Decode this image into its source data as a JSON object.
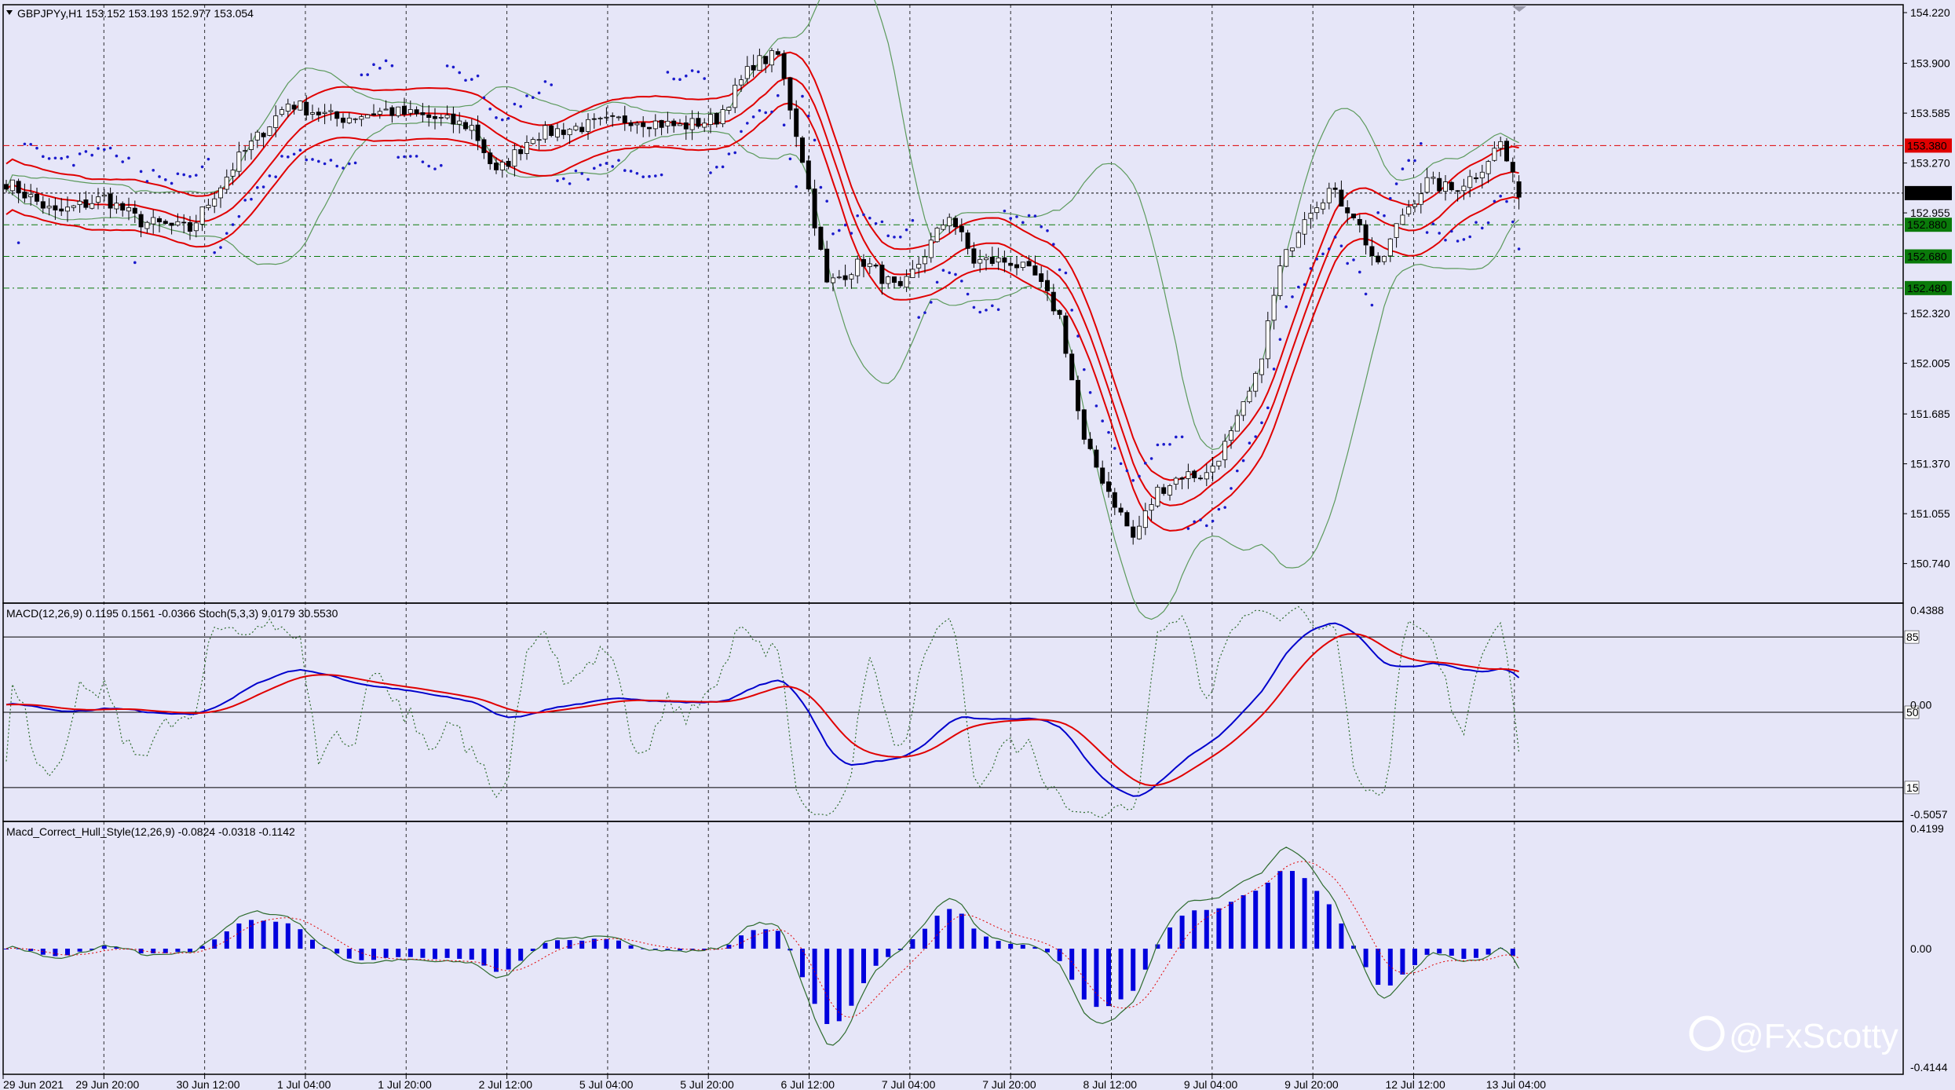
{
  "colors": {
    "background": "#e6e6f8",
    "grid": "#000000",
    "bull_candle": "#ffffff",
    "bear_candle": "#000000",
    "ma_red": "#e00000",
    "bollinger": "#5c9a5c",
    "sar": "#1a1acc",
    "macd_blue": "#0000cc",
    "macd_red": "#e00000",
    "stoch_green": "#2d6b2d",
    "hull_hist": "#0000dd",
    "price_red": "#e00000",
    "price_green": "#0a7a0a",
    "price_current": "#000000"
  },
  "header": {
    "symbol_line": "GBPJPYy,H1  153.152 153.193 152.977 153.054",
    "macd_line": "MACD(12,26,9) 0.1195 0.1561 -0.0366  Stoch(5,3,3) 9.0179 30.5530",
    "hull_line": "Macd_Correct_Hull_Style(12,26,9) -0.0824 -0.0318 -0.1142"
  },
  "watermark": "@FxScotty",
  "chart_data": [
    {
      "type": "candlestick",
      "title": "GBPJPYy,H1",
      "ylim": [
        150.5,
        154.26
      ],
      "price_ticks": [
        "154.220",
        "153.900",
        "153.585",
        "153.270",
        "152.955",
        "152.320",
        "152.005",
        "151.685",
        "151.370",
        "151.055",
        "150.740"
      ],
      "price_ticks_values": [
        154.22,
        153.9,
        153.585,
        153.27,
        152.955,
        152.32,
        152.005,
        151.685,
        151.37,
        151.055,
        150.74
      ],
      "levels": [
        {
          "label": "153.380",
          "value": 153.38,
          "color": "red"
        },
        {
          "label": "153.080",
          "value": 153.08,
          "color": "current"
        },
        {
          "label": "152.880",
          "value": 152.88,
          "color": "green"
        },
        {
          "label": "152.680",
          "value": 152.68,
          "color": "green"
        },
        {
          "label": "152.480",
          "value": 152.48,
          "color": "green"
        }
      ],
      "x_labels": [
        "29 Jun 2021",
        "29 Jun 20:00",
        "30 Jun 12:00",
        "1 Jul 04:00",
        "1 Jul 20:00",
        "2 Jul 12:00",
        "5 Jul 04:00",
        "5 Jul 20:00",
        "6 Jul 12:00",
        "7 Jul 04:00",
        "7 Jul 20:00",
        "8 Jul 12:00",
        "9 Jul 04:00",
        "9 Jul 20:00",
        "12 Jul 12:00",
        "13 Jul 04:00"
      ],
      "anchors": [
        {
          "bar": 0,
          "close": 153.15
        },
        {
          "bar": 8,
          "close": 152.95
        },
        {
          "bar": 16,
          "close": 153.05
        },
        {
          "bar": 22,
          "close": 152.9
        },
        {
          "bar": 30,
          "close": 152.85
        },
        {
          "bar": 38,
          "close": 153.3
        },
        {
          "bar": 46,
          "close": 153.65
        },
        {
          "bar": 54,
          "close": 153.55
        },
        {
          "bar": 62,
          "close": 153.6
        },
        {
          "bar": 70,
          "close": 153.55
        },
        {
          "bar": 76,
          "close": 153.5
        },
        {
          "bar": 80,
          "close": 153.2
        },
        {
          "bar": 86,
          "close": 153.45
        },
        {
          "bar": 94,
          "close": 153.5
        },
        {
          "bar": 102,
          "close": 153.55
        },
        {
          "bar": 110,
          "close": 153.5
        },
        {
          "bar": 116,
          "close": 153.55
        },
        {
          "bar": 122,
          "close": 153.9
        },
        {
          "bar": 126,
          "close": 153.95
        },
        {
          "bar": 130,
          "close": 153.3
        },
        {
          "bar": 134,
          "close": 152.5
        },
        {
          "bar": 140,
          "close": 152.65
        },
        {
          "bar": 146,
          "close": 152.45
        },
        {
          "bar": 150,
          "close": 152.7
        },
        {
          "bar": 154,
          "close": 152.95
        },
        {
          "bar": 158,
          "close": 152.65
        },
        {
          "bar": 164,
          "close": 152.65
        },
        {
          "bar": 168,
          "close": 152.55
        },
        {
          "bar": 172,
          "close": 152.3
        },
        {
          "bar": 176,
          "close": 151.5
        },
        {
          "bar": 180,
          "close": 151.2
        },
        {
          "bar": 184,
          "close": 150.9
        },
        {
          "bar": 188,
          "close": 151.2
        },
        {
          "bar": 192,
          "close": 151.3
        },
        {
          "bar": 196,
          "close": 151.3
        },
        {
          "bar": 200,
          "close": 151.55
        },
        {
          "bar": 204,
          "close": 151.9
        },
        {
          "bar": 208,
          "close": 152.6
        },
        {
          "bar": 212,
          "close": 152.95
        },
        {
          "bar": 216,
          "close": 153.1
        },
        {
          "bar": 220,
          "close": 152.95
        },
        {
          "bar": 224,
          "close": 152.6
        },
        {
          "bar": 228,
          "close": 152.95
        },
        {
          "bar": 232,
          "close": 153.15
        },
        {
          "bar": 236,
          "close": 153.1
        },
        {
          "bar": 240,
          "close": 153.2
        },
        {
          "bar": 244,
          "close": 153.4
        },
        {
          "bar": 247,
          "close": 153.054
        }
      ],
      "last_bar": {
        "open": 153.152,
        "high": 153.193,
        "low": 152.977,
        "close": 153.054
      }
    },
    {
      "type": "line",
      "title": "MACD(12,26,9) / Stoch(5,3,3)",
      "ylim": [
        -0.5057,
        0.4388
      ],
      "ticks": [
        "0.4388",
        "0.00",
        "-0.5057"
      ],
      "ticks_values": [
        0.4388,
        0.0,
        -0.5057
      ],
      "stoch_levels": [
        "85",
        "50",
        "15"
      ],
      "macd_last": 0.1195,
      "signal_last": 0.1561,
      "stoch_main_last": 9.0179,
      "stoch_signal_last": 30.553
    },
    {
      "type": "bar",
      "title": "Macd_Correct_Hull_Style(12,26,9)",
      "ylim": [
        -0.4144,
        0.4199
      ],
      "ticks": [
        "0.4199",
        "0.00",
        "-0.4144"
      ],
      "ticks_values": [
        0.4199,
        0.0,
        -0.4144
      ],
      "last_values": [
        -0.0824,
        -0.0318,
        -0.1142
      ]
    }
  ]
}
